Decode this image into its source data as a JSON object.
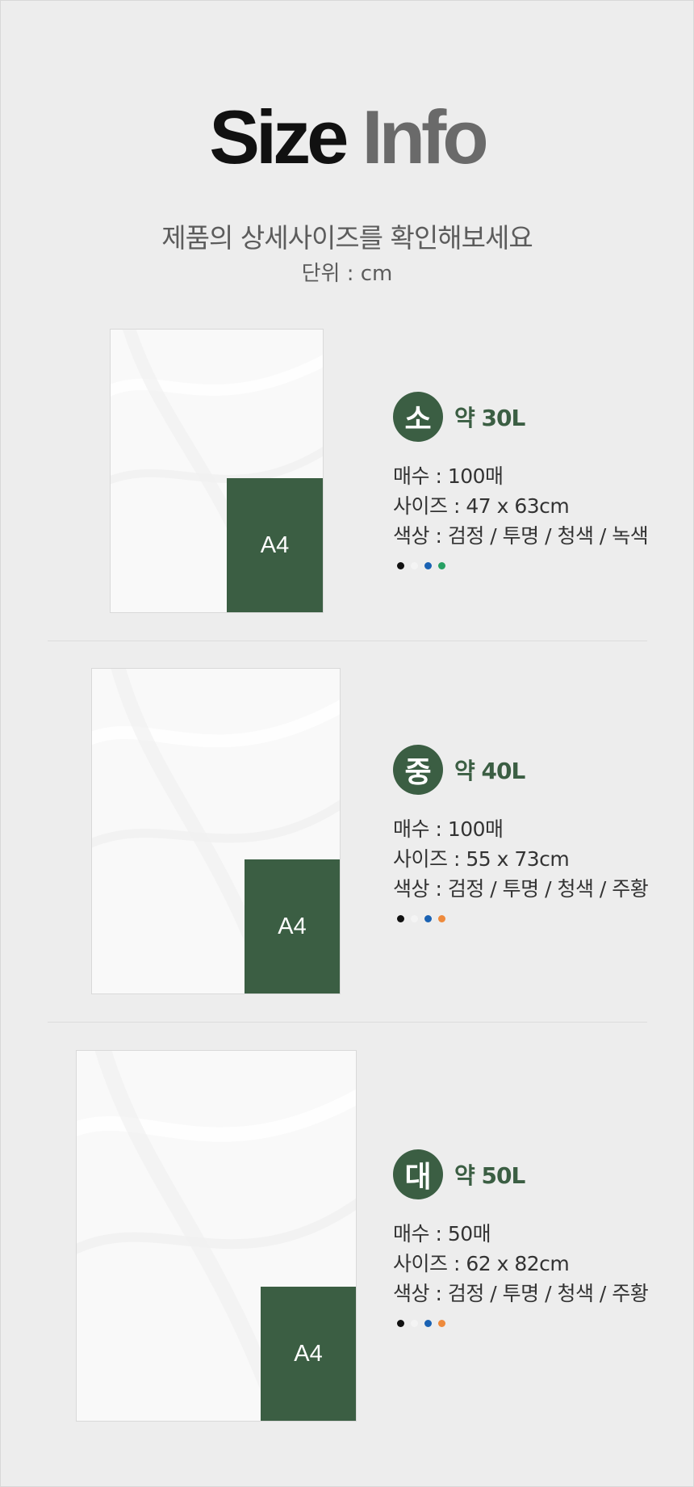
{
  "header": {
    "title_word1": "Size",
    "title_word2": "Info",
    "subtitle": "제품의 상세사이즈를 확인해보세요",
    "unit": "단위 : cm"
  },
  "a4_label": "A4",
  "products": [
    {
      "badge": "소",
      "volume": "약 30L",
      "count": "매수 : 100매",
      "size": "사이즈 : 47 x 63cm",
      "colors": "색상 : 검정 / 투명 / 청색 / 녹색",
      "dots": [
        {
          "name": "검정",
          "hex": "#111111"
        },
        {
          "name": "투명",
          "hex": "#f4f4f4"
        },
        {
          "name": "청색",
          "hex": "#1a62b3"
        },
        {
          "name": "녹색",
          "hex": "#27a063"
        }
      ]
    },
    {
      "badge": "중",
      "volume": "약 40L",
      "count": "매수 : 100매",
      "size": "사이즈 : 55 x 73cm",
      "colors": "색상 : 검정 / 투명 / 청색 / 주황",
      "dots": [
        {
          "name": "검정",
          "hex": "#111111"
        },
        {
          "name": "투명",
          "hex": "#f4f4f4"
        },
        {
          "name": "청색",
          "hex": "#1a62b3"
        },
        {
          "name": "주황",
          "hex": "#ee8a3c"
        }
      ]
    },
    {
      "badge": "대",
      "volume": "약 50L",
      "count": "매수 : 50매",
      "size": "사이즈 : 62 x 82cm",
      "colors": "색상 : 검정 / 투명 / 청색 / 주황",
      "dots": [
        {
          "name": "검정",
          "hex": "#111111"
        },
        {
          "name": "투명",
          "hex": "#f4f4f4"
        },
        {
          "name": "청색",
          "hex": "#1a62b3"
        },
        {
          "name": "주황",
          "hex": "#ee8a3c"
        }
      ]
    }
  ]
}
